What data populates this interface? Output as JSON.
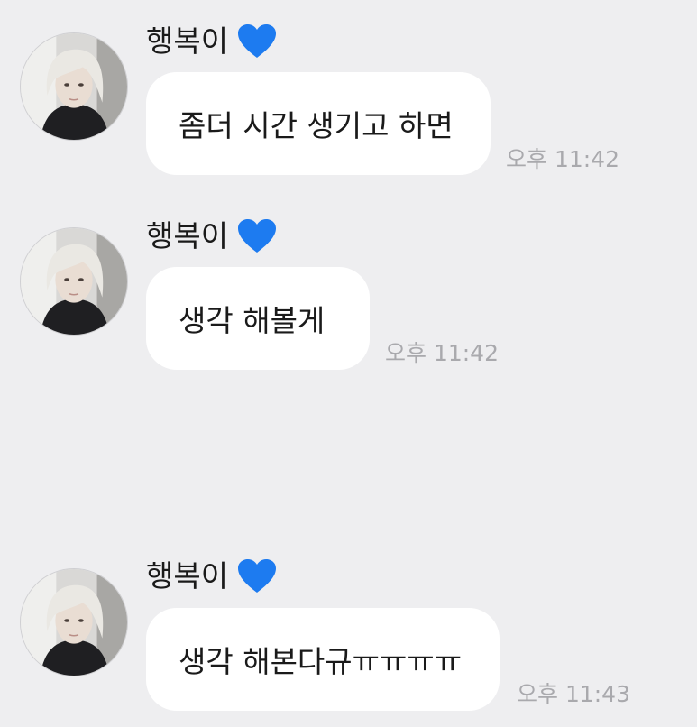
{
  "messages": [
    {
      "sender": "행복이",
      "heart_icon": "blue-heart-icon",
      "text": "좀더 시간 생기고 하면",
      "time": "오후 11:42"
    },
    {
      "sender": "행복이",
      "heart_icon": "blue-heart-icon",
      "text": "생각 해볼게",
      "time": "오후 11:42"
    },
    {
      "sender": "행복이",
      "heart_icon": "blue-heart-icon",
      "text": "생각 해본다규ㅠㅠㅠㅠ",
      "time": "오후 11:43"
    }
  ],
  "colors": {
    "background": "#eeeef0",
    "bubble": "#ffffff",
    "timestamp": "#a9a9ad",
    "heart": "#1d7bf0"
  }
}
